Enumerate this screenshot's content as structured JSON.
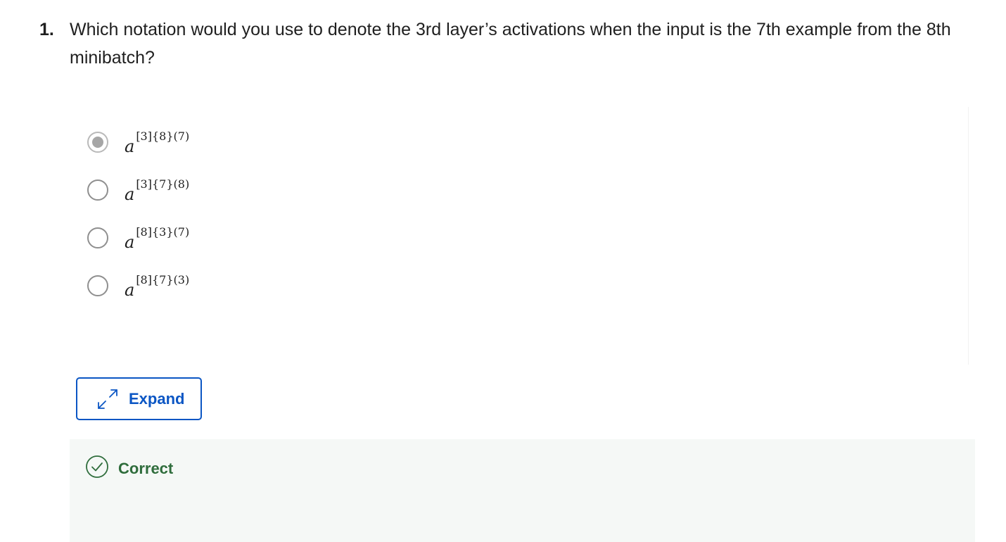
{
  "question": {
    "number": "1.",
    "text": "Which notation would you use to denote the 3rd layer’s activations when the input is the 7th example from the 8th minibatch?"
  },
  "options": [
    {
      "base": "a",
      "superscript": "[3]{8}(7)",
      "selected": true
    },
    {
      "base": "a",
      "superscript": "[3]{7}(8)",
      "selected": false
    },
    {
      "base": "a",
      "superscript": "[8]{3}(7)",
      "selected": false
    },
    {
      "base": "a",
      "superscript": "[8]{7}(3)",
      "selected": false
    }
  ],
  "expand_button": {
    "label": "Expand",
    "icon": "expand-arrows-icon"
  },
  "feedback": {
    "label": "Correct",
    "icon": "check-circle-icon"
  },
  "colors": {
    "accent": "#0b56c4",
    "success": "#2f6d3c",
    "feedback_bg": "#f5f8f6",
    "radio_selected": "#a6a6a6"
  }
}
